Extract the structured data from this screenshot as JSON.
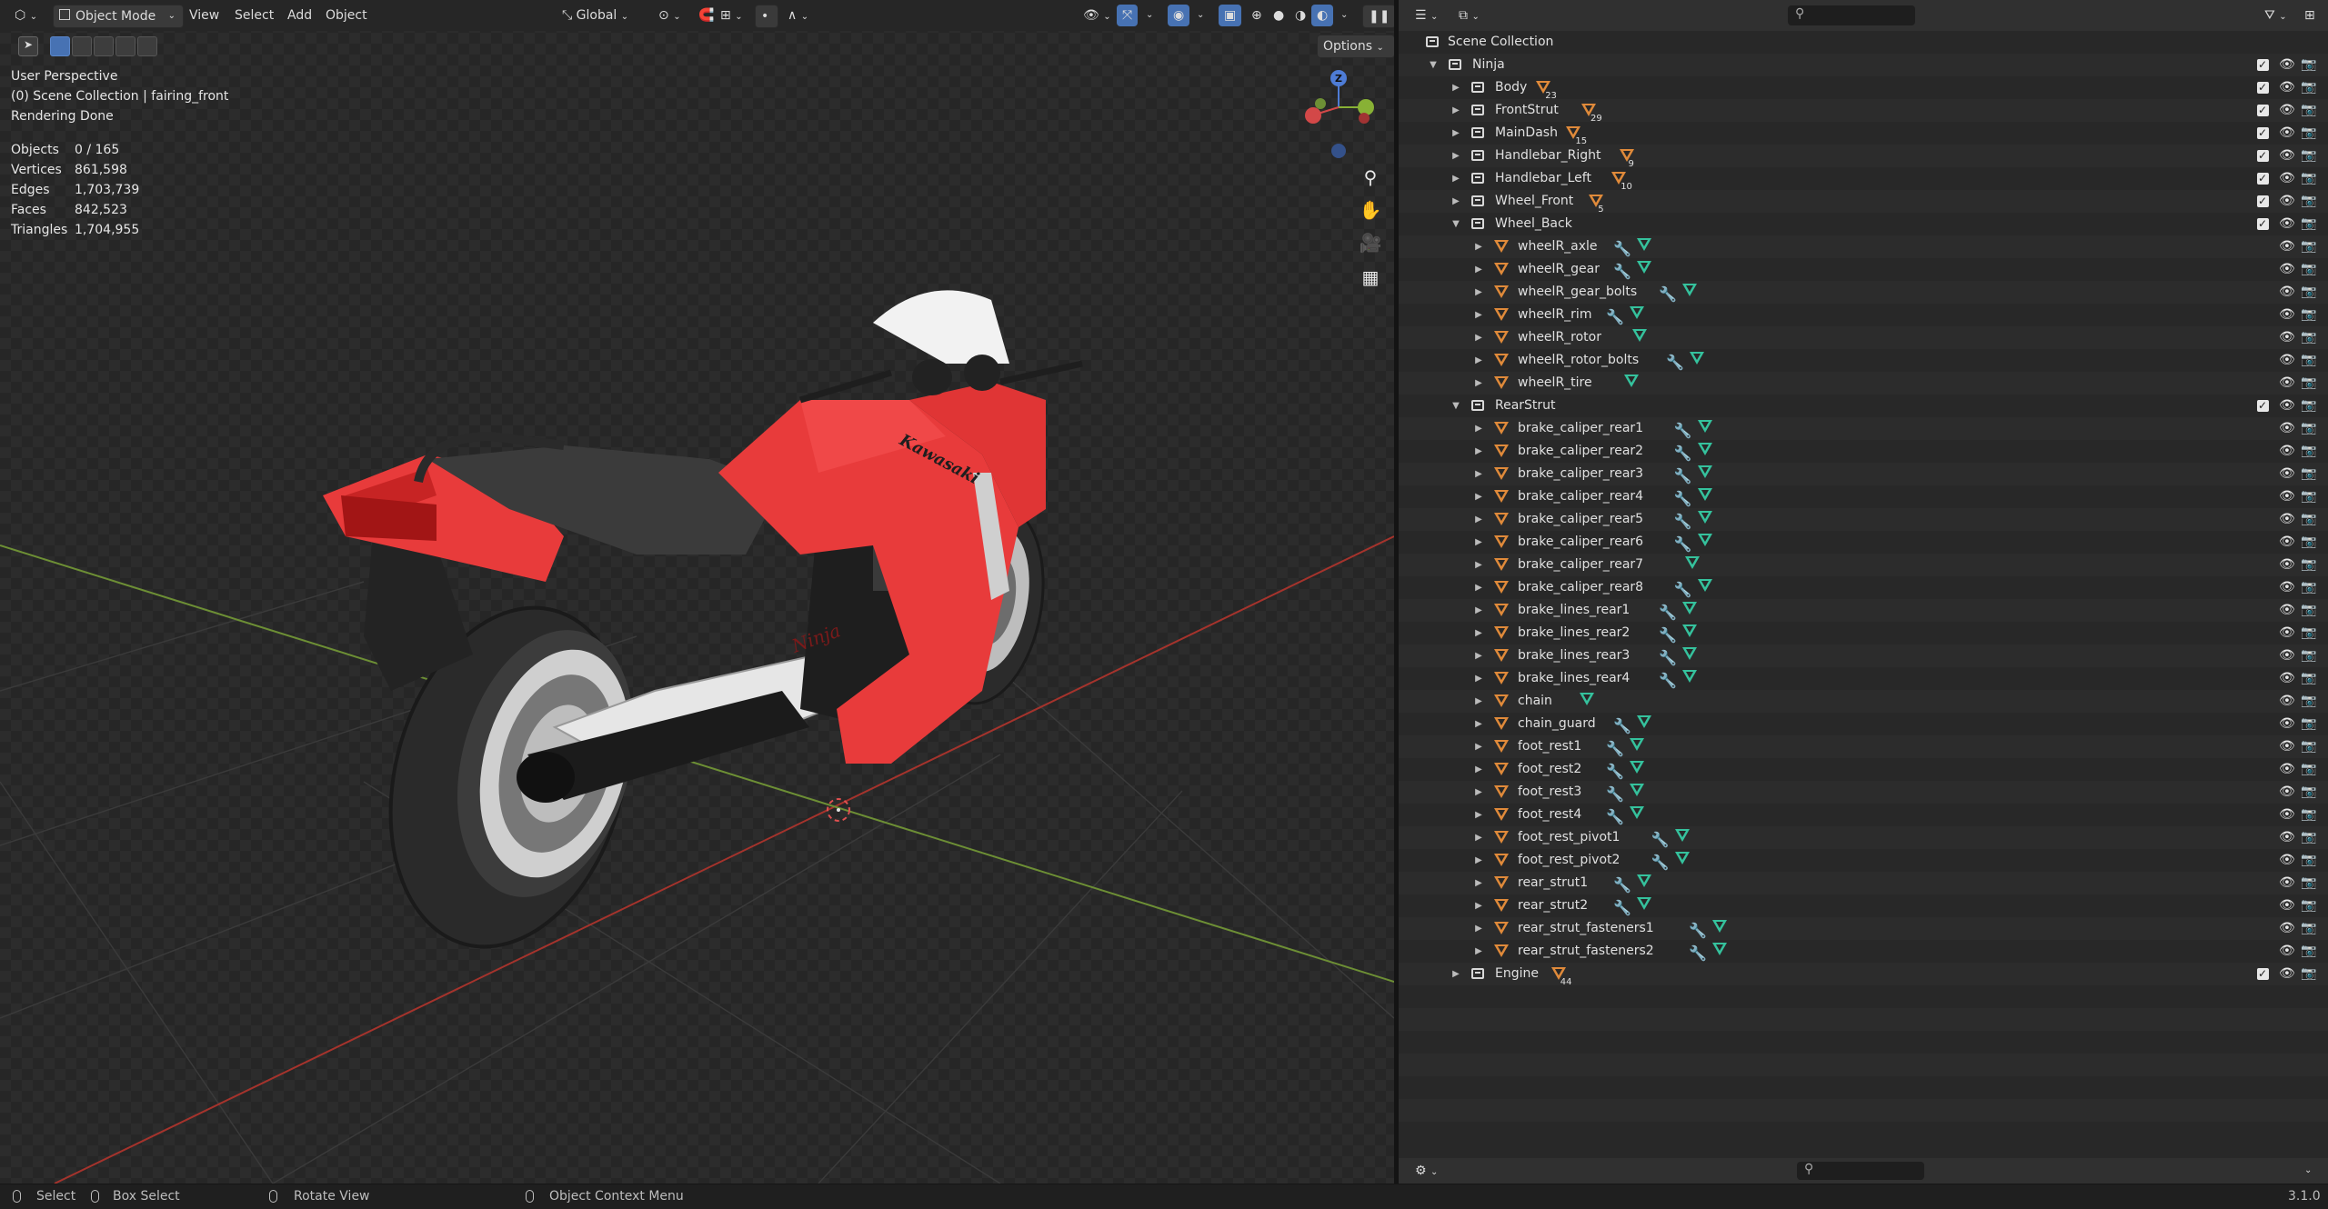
{
  "header": {
    "editor_type_icon": "cube-editor-icon",
    "mode": "Object Mode",
    "menus": [
      "View",
      "Select",
      "Add",
      "Object"
    ],
    "transform_orientation": "Global",
    "options_label": "Options"
  },
  "viewport": {
    "overlay_lines": [
      "User Perspective",
      "(0) Scene Collection | fairing_front",
      "Rendering Done"
    ],
    "stats": [
      {
        "label": "Objects",
        "value": "0 / 165"
      },
      {
        "label": "Vertices",
        "value": "861,598"
      },
      {
        "label": "Edges",
        "value": "1,703,739"
      },
      {
        "label": "Faces",
        "value": "842,523"
      },
      {
        "label": "Triangles",
        "value": "1,704,955"
      }
    ],
    "gizmo": {
      "z": "Z",
      "y": "Y",
      "x": "X"
    },
    "bike_labels": {
      "tank_logo": "Kawasaki",
      "side_logo": "Ninja"
    },
    "nav_icons": [
      "zoom-icon",
      "pan-hand-icon",
      "camera-icon",
      "grid-view-icon"
    ]
  },
  "outliner": {
    "root": "Scene Collection",
    "items": [
      {
        "label": "Ninja",
        "type": "collection",
        "depth": 0,
        "expanded": true,
        "checkbox": true
      },
      {
        "label": "Body",
        "type": "collection",
        "depth": 1,
        "expanded": false,
        "count": "23",
        "checkbox": true
      },
      {
        "label": "FrontStrut",
        "type": "collection",
        "depth": 1,
        "expanded": false,
        "count": "29",
        "checkbox": true
      },
      {
        "label": "MainDash",
        "type": "collection",
        "depth": 1,
        "expanded": false,
        "count": "15",
        "checkbox": true
      },
      {
        "label": "Handlebar_Right",
        "type": "collection",
        "depth": 1,
        "expanded": false,
        "count": "9",
        "checkbox": true
      },
      {
        "label": "Handlebar_Left",
        "type": "collection",
        "depth": 1,
        "expanded": false,
        "count": "10",
        "checkbox": true
      },
      {
        "label": "Wheel_Front",
        "type": "collection",
        "depth": 1,
        "expanded": false,
        "count": "5",
        "checkbox": true
      },
      {
        "label": "Wheel_Back",
        "type": "collection",
        "depth": 1,
        "expanded": true,
        "checkbox": true
      },
      {
        "label": "wheelR_axle",
        "type": "object",
        "depth": 2,
        "modifier": true
      },
      {
        "label": "wheelR_gear",
        "type": "object",
        "depth": 2,
        "modifier": true
      },
      {
        "label": "wheelR_gear_bolts",
        "type": "object",
        "depth": 2,
        "modifier": true
      },
      {
        "label": "wheelR_rim",
        "type": "object",
        "depth": 2,
        "modifier": true
      },
      {
        "label": "wheelR_rotor",
        "type": "object",
        "depth": 2,
        "modifier": false
      },
      {
        "label": "wheelR_rotor_bolts",
        "type": "object",
        "depth": 2,
        "modifier": true
      },
      {
        "label": "wheelR_tire",
        "type": "object",
        "depth": 2,
        "modifier": false
      },
      {
        "label": "RearStrut",
        "type": "collection",
        "depth": 1,
        "expanded": true,
        "checkbox": true
      },
      {
        "label": "brake_caliper_rear1",
        "type": "object",
        "depth": 2,
        "modifier": true
      },
      {
        "label": "brake_caliper_rear2",
        "type": "object",
        "depth": 2,
        "modifier": true
      },
      {
        "label": "brake_caliper_rear3",
        "type": "object",
        "depth": 2,
        "modifier": true
      },
      {
        "label": "brake_caliper_rear4",
        "type": "object",
        "depth": 2,
        "modifier": true
      },
      {
        "label": "brake_caliper_rear5",
        "type": "object",
        "depth": 2,
        "modifier": true
      },
      {
        "label": "brake_caliper_rear6",
        "type": "object",
        "depth": 2,
        "modifier": true
      },
      {
        "label": "brake_caliper_rear7",
        "type": "object",
        "depth": 2,
        "modifier": false
      },
      {
        "label": "brake_caliper_rear8",
        "type": "object",
        "depth": 2,
        "modifier": true
      },
      {
        "label": "brake_lines_rear1",
        "type": "object",
        "depth": 2,
        "modifier": true
      },
      {
        "label": "brake_lines_rear2",
        "type": "object",
        "depth": 2,
        "modifier": true
      },
      {
        "label": "brake_lines_rear3",
        "type": "object",
        "depth": 2,
        "modifier": true
      },
      {
        "label": "brake_lines_rear4",
        "type": "object",
        "depth": 2,
        "modifier": true
      },
      {
        "label": "chain",
        "type": "object",
        "depth": 2,
        "modifier": false
      },
      {
        "label": "chain_guard",
        "type": "object",
        "depth": 2,
        "modifier": true
      },
      {
        "label": "foot_rest1",
        "type": "object",
        "depth": 2,
        "modifier": true
      },
      {
        "label": "foot_rest2",
        "type": "object",
        "depth": 2,
        "modifier": true
      },
      {
        "label": "foot_rest3",
        "type": "object",
        "depth": 2,
        "modifier": true
      },
      {
        "label": "foot_rest4",
        "type": "object",
        "depth": 2,
        "modifier": true
      },
      {
        "label": "foot_rest_pivot1",
        "type": "object",
        "depth": 2,
        "modifier": true
      },
      {
        "label": "foot_rest_pivot2",
        "type": "object",
        "depth": 2,
        "modifier": true
      },
      {
        "label": "rear_strut1",
        "type": "object",
        "depth": 2,
        "modifier": true
      },
      {
        "label": "rear_strut2",
        "type": "object",
        "depth": 2,
        "modifier": true
      },
      {
        "label": "rear_strut_fasteners1",
        "type": "object",
        "depth": 2,
        "modifier": true
      },
      {
        "label": "rear_strut_fasteners2",
        "type": "object",
        "depth": 2,
        "modifier": true
      },
      {
        "label": "Engine",
        "type": "collection",
        "depth": 1,
        "expanded": false,
        "count": "44",
        "checkbox": true
      }
    ]
  },
  "statusbar": {
    "items": [
      "Select",
      "Box Select",
      "Rotate View",
      "Object Context Menu"
    ],
    "version": "3.1.0"
  },
  "colors": {
    "object_orange": "#e08a3a",
    "mesh_green": "#35c29d",
    "modifier_blue": "#6a8fe0",
    "bike_red": "#e83b3b",
    "x_axis": "#c0392b",
    "y_axis": "#7da43a"
  }
}
